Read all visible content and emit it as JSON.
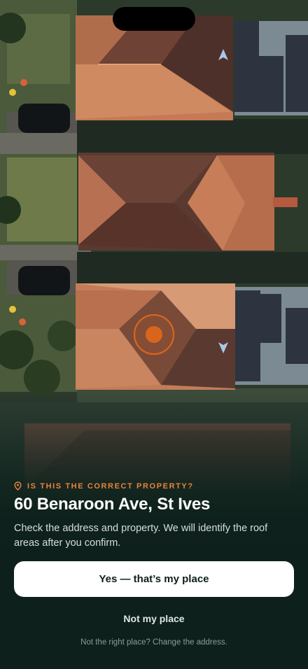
{
  "map": {
    "accent": "#d9651c",
    "marker_name": "property-location-marker",
    "compass_icons": [
      "navigation-arrow-up-icon",
      "navigation-arrow-down-icon"
    ]
  },
  "prompt": {
    "eyebrow": "IS THIS THE CORRECT PROPERTY?",
    "eyebrow_icon": "location-pin-icon",
    "address": "60 Benaroon Ave, St Ives",
    "description": "Check the address and property. We will identify the roof areas after you confirm."
  },
  "actions": {
    "confirm_label": "Yes — that’s my place",
    "decline_label": "Not my place",
    "change_address_label": "Not the right place? Change the address."
  },
  "colors": {
    "accent": "#e8833a",
    "sheet_bg": "#0e201b",
    "primary_button_bg": "#ffffff",
    "primary_button_text": "#0e1f1a"
  }
}
